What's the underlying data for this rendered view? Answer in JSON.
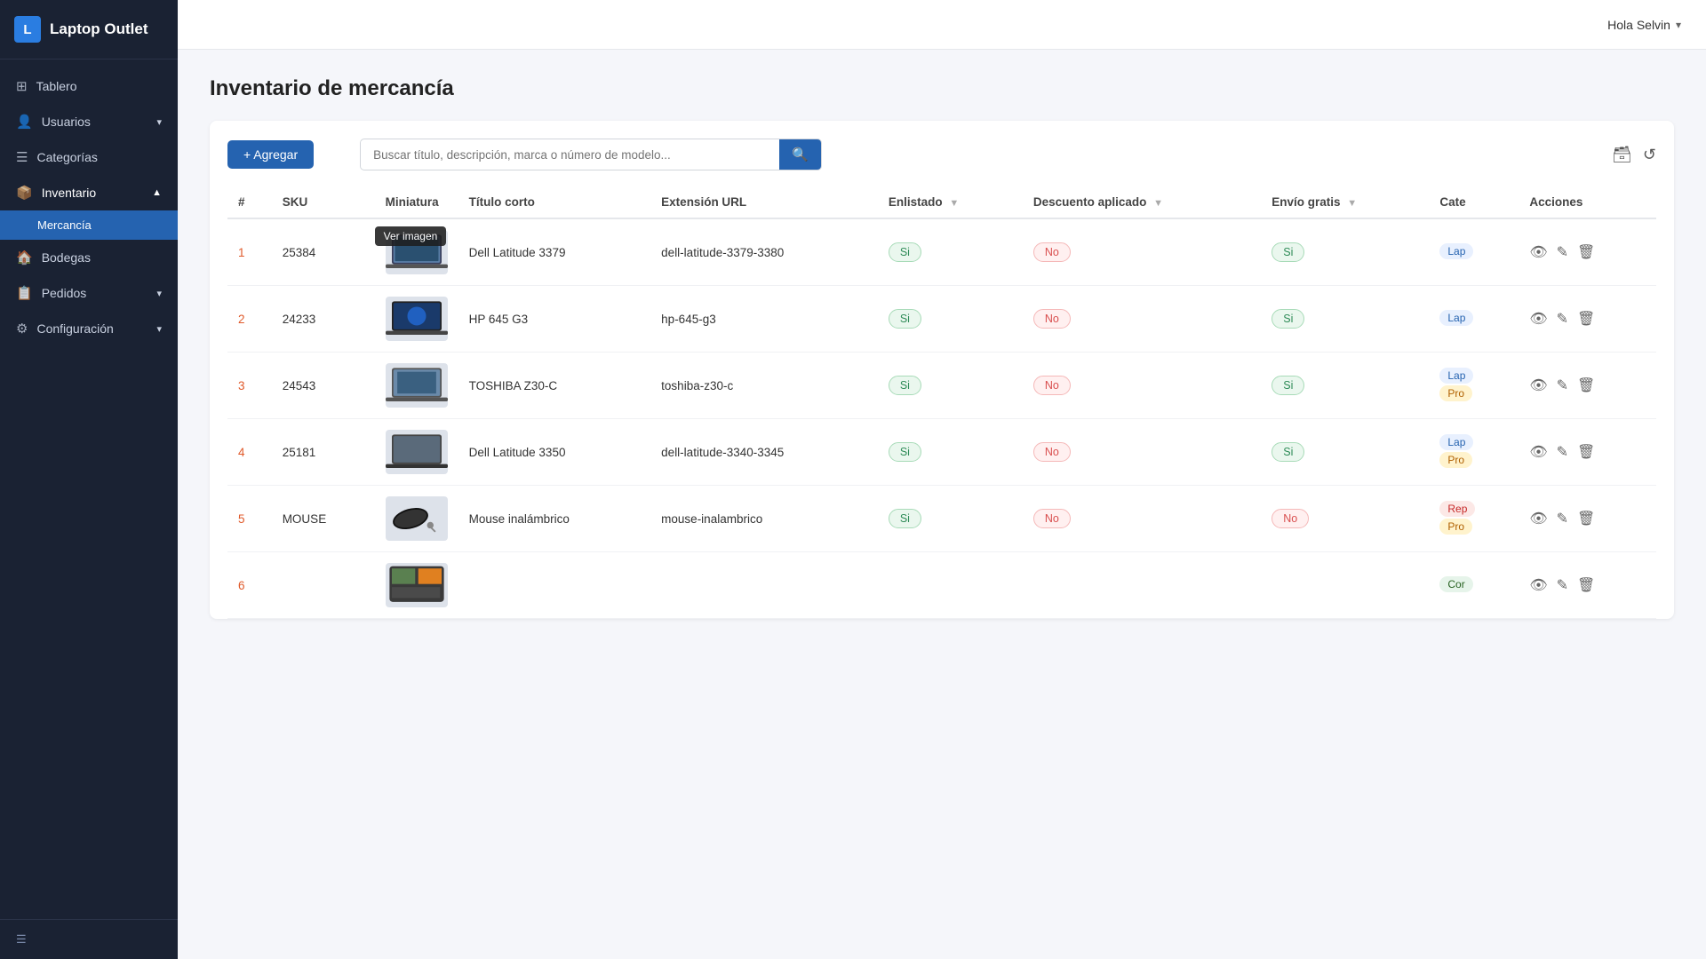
{
  "app": {
    "logo_letter": "L",
    "title": "Laptop Outlet"
  },
  "sidebar": {
    "nav_items": [
      {
        "id": "tablero",
        "label": "Tablero",
        "icon": "⊞",
        "active": false,
        "sub": []
      },
      {
        "id": "usuarios",
        "label": "Usuarios",
        "icon": "👤",
        "active": false,
        "has_sub": true,
        "sub": []
      },
      {
        "id": "categorias",
        "label": "Categorías",
        "icon": "☰",
        "active": false,
        "sub": []
      },
      {
        "id": "inventario",
        "label": "Inventario",
        "icon": "📦",
        "active": true,
        "has_sub": true,
        "sub": [
          {
            "id": "mercancia",
            "label": "Mercancía",
            "active": true
          }
        ]
      },
      {
        "id": "bodegas",
        "label": "Bodegas",
        "icon": "🏠",
        "active": false,
        "sub": []
      },
      {
        "id": "pedidos",
        "label": "Pedidos",
        "icon": "📋",
        "active": false,
        "has_sub": true,
        "sub": []
      },
      {
        "id": "configuracion",
        "label": "Configuración",
        "icon": "⚙",
        "active": false,
        "has_sub": true,
        "sub": []
      }
    ],
    "footer_icon": "☰"
  },
  "topbar": {
    "user_greeting": "Hola Selvin",
    "chevron": "▾"
  },
  "page": {
    "title": "Inventario de mercancía"
  },
  "toolbar": {
    "add_label": "+ Agregar",
    "search_placeholder": "Buscar título, descripción, marca o número de modelo...",
    "refresh_icon": "↺",
    "box_icon": "🗃"
  },
  "table": {
    "columns": [
      {
        "id": "num",
        "label": "#"
      },
      {
        "id": "sku",
        "label": "SKU"
      },
      {
        "id": "miniatura",
        "label": "Miniatura"
      },
      {
        "id": "titulo",
        "label": "Título corto"
      },
      {
        "id": "url",
        "label": "Extensión URL"
      },
      {
        "id": "enlistado",
        "label": "Enlistado",
        "filter": true
      },
      {
        "id": "descuento",
        "label": "Descuento aplicado",
        "filter": true
      },
      {
        "id": "envio",
        "label": "Envío gratis",
        "filter": true
      },
      {
        "id": "cate",
        "label": "Cate"
      },
      {
        "id": "acciones",
        "label": "Acciones"
      }
    ],
    "rows": [
      {
        "num": "1",
        "sku": "25384",
        "title": "Dell Latitude 3379",
        "url": "dell-latitude-3379-3380",
        "enlistado": "Si",
        "descuento": "No",
        "envio": "Si",
        "categories": [
          "Lap"
        ],
        "tooltip": "Ver imagen",
        "show_tooltip": true,
        "color_enlistado": "yes",
        "color_descuento": "no",
        "color_envio": "yes"
      },
      {
        "num": "2",
        "sku": "24233",
        "title": "HP 645 G3",
        "url": "hp-645-g3",
        "enlistado": "Si",
        "descuento": "No",
        "envio": "Si",
        "categories": [
          "Lap"
        ],
        "tooltip": "",
        "show_tooltip": false,
        "color_enlistado": "yes",
        "color_descuento": "no",
        "color_envio": "yes"
      },
      {
        "num": "3",
        "sku": "24543",
        "title": "TOSHIBA Z30-C",
        "url": "toshiba-z30-c",
        "enlistado": "Si",
        "descuento": "No",
        "envio": "Si",
        "categories": [
          "Lap",
          "Pro"
        ],
        "tooltip": "",
        "show_tooltip": false,
        "color_enlistado": "yes",
        "color_descuento": "no",
        "color_envio": "yes"
      },
      {
        "num": "4",
        "sku": "25181",
        "title": "Dell Latitude 3350",
        "url": "dell-latitude-3340-3345",
        "enlistado": "Si",
        "descuento": "No",
        "envio": "Si",
        "categories": [
          "Lap",
          "Pro"
        ],
        "tooltip": "",
        "show_tooltip": false,
        "color_enlistado": "yes",
        "color_descuento": "no",
        "color_envio": "yes"
      },
      {
        "num": "5",
        "sku": "MOUSE",
        "title": "Mouse inalámbrico",
        "url": "mouse-inalambrico",
        "enlistado": "Si",
        "descuento": "No",
        "envio": "No",
        "categories": [
          "Rep",
          "Pro"
        ],
        "tooltip": "",
        "show_tooltip": false,
        "color_enlistado": "yes",
        "color_descuento": "no",
        "color_envio": "no"
      },
      {
        "num": "6",
        "sku": "",
        "title": "",
        "url": "",
        "enlistado": "",
        "descuento": "",
        "envio": "",
        "categories": [
          "Cor"
        ],
        "tooltip": "",
        "show_tooltip": false,
        "color_enlistado": "",
        "color_descuento": "",
        "color_envio": ""
      }
    ]
  }
}
